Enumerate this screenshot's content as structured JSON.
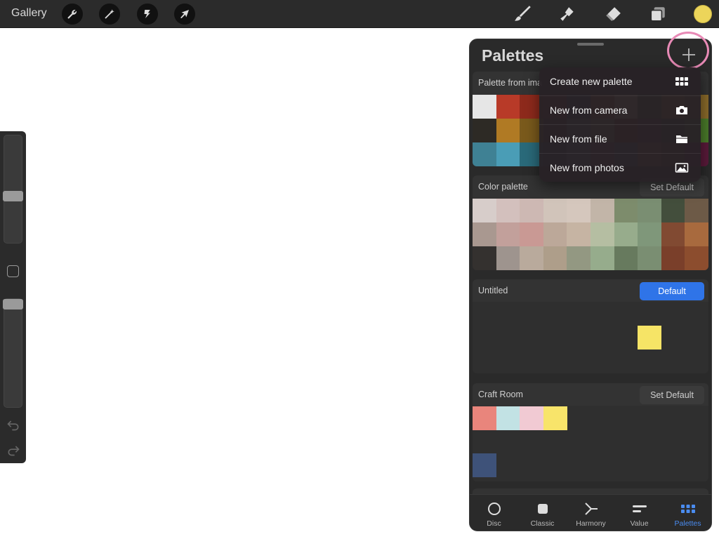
{
  "toolbar": {
    "gallery_label": "Gallery",
    "left_tools": [
      "wrench-icon",
      "magic-wand-icon",
      "selection-icon",
      "transform-arrow-icon"
    ],
    "right_tools": [
      "brush-icon",
      "smudge-icon",
      "eraser-icon",
      "layers-icon"
    ],
    "current_color": "#ecd55a"
  },
  "panel": {
    "title": "Palettes",
    "add_icon": "plus-icon",
    "highlight_color": "#e88ab6"
  },
  "menu": {
    "items": [
      {
        "label": "Create new palette",
        "icon": "grid-icon"
      },
      {
        "label": "New from camera",
        "icon": "camera-icon"
      },
      {
        "label": "New from file",
        "icon": "folder-icon"
      },
      {
        "label": "New from photos",
        "icon": "photo-icon"
      }
    ]
  },
  "palettes": [
    {
      "name": "Palette from ima",
      "button": "",
      "swatches": [
        [
          "#e6e6e6",
          "#b83a28",
          "#8e2a1c",
          "#7a3020",
          "#1f3a5a",
          "#c46a2a",
          "#e6d6a6",
          "#3a6a2a",
          "#b07a2a",
          "#8a6a2a"
        ],
        [
          "#2d2a25",
          "#b07a24",
          "#7a5a1c",
          "#3a3025",
          "#6a7a8a",
          "#a0a060",
          "#8a2a1a",
          "#5a2a3a",
          "#2a4a2a",
          "#4a7a2a"
        ],
        [
          "#3f8194",
          "#4a9db6",
          "#2a6a7a",
          "#1f4a5a",
          "#5a8aa0",
          "#7a3a5a",
          "#3a5a7a",
          "#a06a3a",
          "#6a3a2a",
          "#5a1a3a"
        ]
      ]
    },
    {
      "name": "Color palette",
      "button": "Set Default",
      "swatches": [
        [
          "#d7cdca",
          "#d3c0bd",
          "#cdb8b3",
          "#d1c4ba",
          "#d5c7bd",
          "#c2b5a8",
          "#7d8c6c",
          "#7a8e72",
          "#434e3c",
          "#6d5a47"
        ],
        [
          "#a99890",
          "#c2a09b",
          "#c99994",
          "#bca899",
          "#c6b4a3",
          "#b5bea2",
          "#97ac8c",
          "#7f977a",
          "#814a32",
          "#a86a3e"
        ],
        [
          "#34312f",
          "#9e948e",
          "#b9aa9c",
          "#ae9e8a",
          "#939882",
          "#96ac8c",
          "#677a5e",
          "#7a8e72",
          "#7a3f2a",
          "#8c4d2e"
        ]
      ]
    },
    {
      "name": "Untitled",
      "button": "Default",
      "swatch_color": "#f6e466"
    },
    {
      "name": "Craft Room",
      "button": "Set Default",
      "row1": [
        "#e9857c",
        "#c2e2e4",
        "#f1cad3",
        "#f8e46a"
      ],
      "row2": [
        "#3e5279"
      ]
    }
  ],
  "tabs": [
    {
      "label": "Disc",
      "icon": "disc-icon"
    },
    {
      "label": "Classic",
      "icon": "classic-square-icon"
    },
    {
      "label": "Harmony",
      "icon": "harmony-icon"
    },
    {
      "label": "Value",
      "icon": "value-bars-icon"
    },
    {
      "label": "Palettes",
      "icon": "palettes-grid-icon"
    }
  ]
}
